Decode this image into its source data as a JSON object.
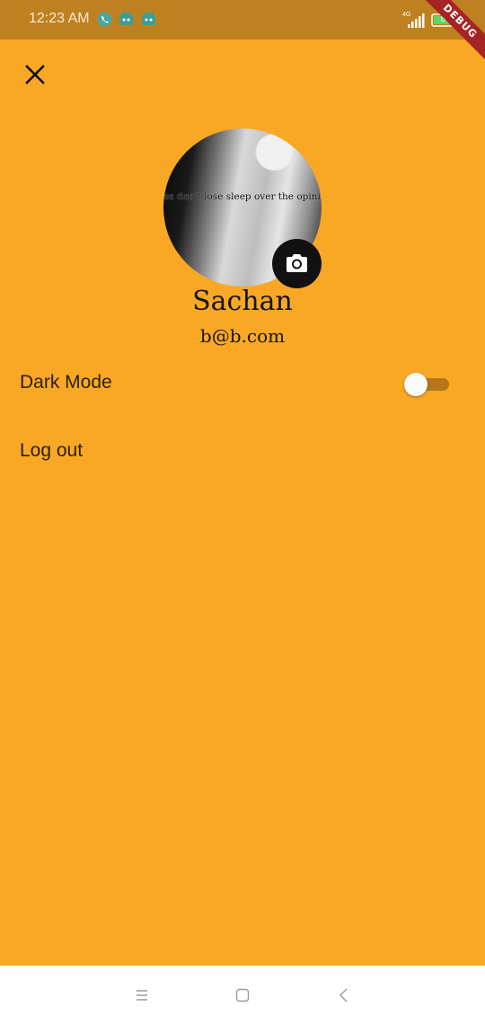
{
  "status_bar": {
    "time": "12:23 AM",
    "network": "4G",
    "battery": "80"
  },
  "debug_banner": "DEBUG",
  "profile": {
    "name": "Sachan",
    "email": "b@b.com",
    "avatar_caption": "ves don't lose sleep over the opinion of"
  },
  "settings": {
    "dark_mode_label": "Dark Mode",
    "dark_mode_on": false,
    "logout_label": "Log out"
  },
  "colors": {
    "background": "#F9A825",
    "status_bar": "#BF8120",
    "toggle_track": "#B77718"
  },
  "icons": {
    "close": "close-icon",
    "camera": "camera-icon",
    "nav_menu": "menu-icon",
    "nav_home": "home-icon",
    "nav_back": "back-icon"
  }
}
